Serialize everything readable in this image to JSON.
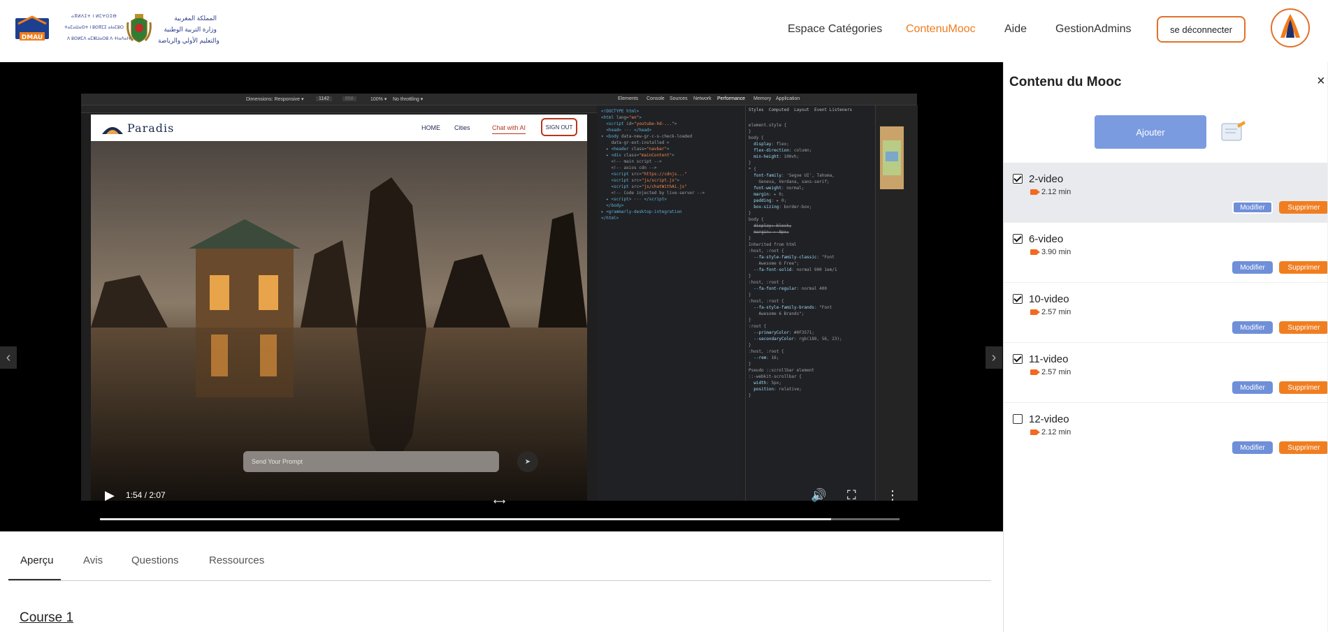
{
  "header": {
    "logo_text_lines": [
      "ⴰⴳⵍⴷⵉⵜ ⵏ ⵍⵎⵖⵔⵉⴱ",
      "ⵜⴰⵎⴰⵡⴰⵙⵜ ⵏ ⵓⵙⴳⵎⵉ ⴰⵏⴰⵎⵓⵔ",
      "ⴷ ⵓⵙⵍⵎⴷ ⴰⵎⵣⵡⴰⵔⵓ ⴷ ⵜⵏⴰⴷⴰⵏⵜ"
    ],
    "logo_ar_lines": [
      "المملكة المغربية",
      "وزارة التربية الوطنية",
      "والتعليم الأولي والرياضة"
    ],
    "nav": [
      "Espace Catégories",
      "ContenuMooc",
      "Aide",
      "GestionAdmins"
    ],
    "active_nav": "ContenuMooc",
    "logout_label": "se déconnecter",
    "accent_color": "#f07c1c"
  },
  "video": {
    "devtools_tabs": [
      "Elements",
      "Console",
      "Sources",
      "Network",
      "Performance",
      "Memory",
      "Application"
    ],
    "devtools_dims": "Dimensions: Responsive ▾",
    "devtools_w": "1142",
    "devtools_h": "858",
    "devtools_zoom": "100% ▾",
    "devtools_throttle": "No throttling ▾",
    "styles_tabs": [
      "Styles",
      "Computed",
      "Layout",
      "Event Listeners"
    ],
    "site": {
      "brand": "Paradis",
      "nav": [
        "HOME",
        "Cities",
        "Chat with AI"
      ],
      "signout": "SIGN OUT",
      "prompt_placeholder": "Send Your Prompt"
    },
    "time_display": "1:54 / 2:07",
    "progress": 0.914
  },
  "tabs": [
    "Aperçu",
    "Avis",
    "Questions",
    "Ressources"
  ],
  "active_tab": "Aperçu",
  "course_title": "Course 1",
  "panel": {
    "title": "Contenu du Mooc",
    "close": "×",
    "add_label": "Ajouter",
    "modify_label": "Modifier",
    "delete_label": "Supprimer",
    "items": [
      {
        "title": "2-video",
        "duration": "2.12 min",
        "checked": true,
        "selected": true
      },
      {
        "title": "6-video",
        "duration": "3.90 min",
        "checked": true,
        "selected": false
      },
      {
        "title": "10-video",
        "duration": "2.57 min",
        "checked": true,
        "selected": false
      },
      {
        "title": "11-video",
        "duration": "2.57 min",
        "checked": true,
        "selected": false
      },
      {
        "title": "12-video",
        "duration": "2.12 min",
        "checked": false,
        "selected": false
      }
    ]
  }
}
